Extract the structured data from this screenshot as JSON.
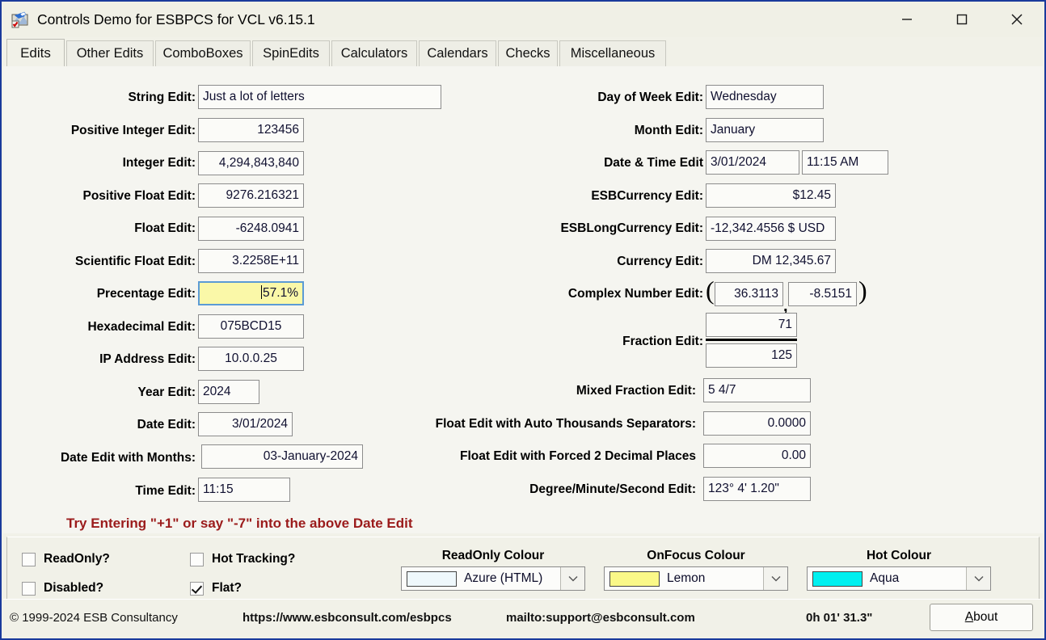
{
  "window": {
    "title": "Controls Demo for ESBPCS for VCL v6.15.1",
    "icon": "app-icon",
    "minimize_glyph": "minimize-icon",
    "maximize_glyph": "maximize-icon",
    "close_glyph": "close-icon",
    "border_color": "#1a3a9c",
    "titlebar_bg": "#f0f0e6"
  },
  "tabs": [
    {
      "label": "Edits",
      "active": true
    },
    {
      "label": "Other Edits",
      "active": false
    },
    {
      "label": "ComboBoxes",
      "active": false
    },
    {
      "label": "SpinEdits",
      "active": false
    },
    {
      "label": "Calculators",
      "active": false
    },
    {
      "label": "Calendars",
      "active": false
    },
    {
      "label": "Checks",
      "active": false
    },
    {
      "label": "Miscellaneous",
      "active": false
    }
  ],
  "left_fields": {
    "string_edit": {
      "label": "String Edit:",
      "value": "Just a lot of letters"
    },
    "positive_integer": {
      "label": "Positive Integer Edit:",
      "value": "123456"
    },
    "integer": {
      "label": "Integer Edit:",
      "value": "4,294,843,840"
    },
    "positive_float": {
      "label": "Positive Float Edit:",
      "value": "9276.216321"
    },
    "float": {
      "label": "Float Edit:",
      "value": "-6248.0941"
    },
    "scientific_float": {
      "label": "Scientific Float Edit:",
      "value": "3.2258E+11"
    },
    "percentage": {
      "label": "Precentage Edit:",
      "value": "57.1%"
    },
    "hexadecimal": {
      "label": "Hexadecimal Edit:",
      "value": "075BCD15"
    },
    "ip_address": {
      "label": "IP Address Edit:",
      "value": "10.0.0.25"
    },
    "year": {
      "label": "Year Edit:",
      "value": "2024"
    },
    "date": {
      "label": "Date Edit:",
      "value": "3/01/2024"
    },
    "date_with_months": {
      "label": "Date Edit with Months:",
      "value": "03-January-2024"
    },
    "time": {
      "label": "Time Edit:",
      "value": "11:15"
    }
  },
  "right_fields": {
    "day_of_week": {
      "label": "Day of Week Edit:",
      "value": "Wednesday"
    },
    "month": {
      "label": "Month Edit:",
      "value": "January"
    },
    "date_time": {
      "label": "Date & Time Edit",
      "date_value": "3/01/2024",
      "time_value": "11:15 AM"
    },
    "esb_currency": {
      "label": "ESBCurrency Edit:",
      "value": "$12.45"
    },
    "esb_long_currency": {
      "label": "ESBLongCurrency Edit:",
      "value": "-12,342.4556 $ USD"
    },
    "currency": {
      "label": "Currency Edit:",
      "value": "DM 12,345.67"
    },
    "complex_number": {
      "label": "Complex Number Edit:",
      "real": "36.3113",
      "imaginary": "-8.5151",
      "open_paren": "(",
      "separator": ",",
      "close_paren": ")"
    },
    "fraction": {
      "label": "Fraction Edit:",
      "numerator": "71",
      "denominator": "125"
    },
    "mixed_fraction": {
      "label": "Mixed Fraction Edit:",
      "value": "5 4/7"
    },
    "float_auto_sep": {
      "label": "Float Edit with Auto Thousands Separators:",
      "value": "0.0000"
    },
    "float_forced_2dp": {
      "label": "Float Edit with Forced 2 Decimal Places",
      "value": "0.00"
    },
    "dms": {
      "label": "Degree/Minute/Second Edit:",
      "value": "123° 4' 1.20\""
    }
  },
  "hint": {
    "text": "Try Entering  \"+1\" or say \"-7\" into the above Date Edit",
    "color": "#9b1b1b"
  },
  "options": {
    "checkboxes": [
      {
        "label": "ReadOnly?",
        "checked": false
      },
      {
        "label": "Disabled?",
        "checked": false
      },
      {
        "label": "Hot Tracking?",
        "checked": false
      },
      {
        "label": "Flat?",
        "checked": true
      }
    ],
    "colour_combos": [
      {
        "title": "ReadOnly Colour",
        "value": "Azure (HTML)",
        "swatch": "#eff8fc"
      },
      {
        "title": "OnFocus Colour",
        "value": "Lemon",
        "swatch": "#faf888"
      },
      {
        "title": "Hot Colour",
        "value": "Aqua",
        "swatch": "#00f0f0"
      }
    ],
    "dropdown_arrow": "chevron-down-icon"
  },
  "statusbar": {
    "copyright": "© 1999-2024 ESB Consultancy",
    "website": "https://www.esbconsult.com/esbpcs",
    "email": "mailto:support@esbconsult.com",
    "timer": "0h 01' 31.3\"",
    "about_underlined": "A",
    "about_rest": "bout"
  }
}
